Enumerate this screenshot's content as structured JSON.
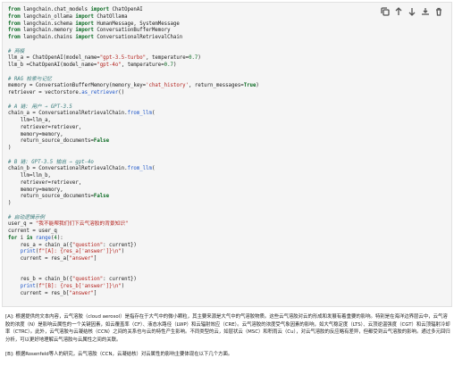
{
  "toolbar": {
    "icons": [
      "copy-icon",
      "move-up-icon",
      "move-down-icon",
      "download-icon",
      "delete-icon"
    ]
  },
  "code_lines": [
    [
      {
        "t": "from",
        "c": "kw"
      },
      {
        "t": " langchain.chat_models "
      },
      {
        "t": "import",
        "c": "kw"
      },
      {
        "t": " ChatOpenAI"
      }
    ],
    [
      {
        "t": "from",
        "c": "kw"
      },
      {
        "t": " langchain_ollama "
      },
      {
        "t": "import",
        "c": "kw"
      },
      {
        "t": " ChatOllama"
      }
    ],
    [
      {
        "t": "from",
        "c": "kw"
      },
      {
        "t": " langchain.schema "
      },
      {
        "t": "import",
        "c": "kw"
      },
      {
        "t": " HumanMessage, SystemMessage"
      }
    ],
    [
      {
        "t": "from",
        "c": "kw"
      },
      {
        "t": " langchain.memory "
      },
      {
        "t": "import",
        "c": "kw"
      },
      {
        "t": " ConversationBufferMemory"
      }
    ],
    [
      {
        "t": "from",
        "c": "kw"
      },
      {
        "t": " langchain.chains "
      },
      {
        "t": "import",
        "c": "kw"
      },
      {
        "t": " ConversationalRetrievalChain"
      }
    ],
    [],
    [
      {
        "t": "# 两模",
        "c": "cm"
      }
    ],
    [
      {
        "t": "llm_a = ChatOpenAI(model_name="
      },
      {
        "t": "\"gpt-3.5-turbo\"",
        "c": "st"
      },
      {
        "t": ", temperature="
      },
      {
        "t": "0.7",
        "c": "nu"
      },
      {
        "t": ")"
      }
    ],
    [
      {
        "t": "llm_b =ChatOpenAI(model_name="
      },
      {
        "t": "\"gpt-4o\"",
        "c": "st"
      },
      {
        "t": ", temperature="
      },
      {
        "t": "0.7",
        "c": "nu"
      },
      {
        "t": ")"
      }
    ],
    [],
    [
      {
        "t": "# RAG 检索与记忆",
        "c": "cm"
      }
    ],
    [
      {
        "t": "memory = ConversationBufferMemory(memory_key="
      },
      {
        "t": "'chat_history'",
        "c": "st"
      },
      {
        "t": ", return_messages="
      },
      {
        "t": "True",
        "c": "kw"
      },
      {
        "t": ")"
      }
    ],
    [
      {
        "t": "retriever = vectorstore."
      },
      {
        "t": "as_retriever",
        "c": "fn"
      },
      {
        "t": "()"
      }
    ],
    [],
    [
      {
        "t": "# A 链: 用户 → GPT-3.5",
        "c": "cm"
      }
    ],
    [
      {
        "t": "chain_a = ConversationalRetrievalChain."
      },
      {
        "t": "from_llm",
        "c": "fn"
      },
      {
        "t": "("
      }
    ],
    [
      {
        "t": "    llm=llm_a,"
      }
    ],
    [
      {
        "t": "    retriever=retriever,"
      }
    ],
    [
      {
        "t": "    memory=memory,"
      }
    ],
    [
      {
        "t": "    return_source_documents="
      },
      {
        "t": "False",
        "c": "kw"
      }
    ],
    [
      {
        "t": ")"
      }
    ],
    [],
    [
      {
        "t": "# B 链: GPT-3.5 输出 → gpt-4o",
        "c": "cm"
      }
    ],
    [
      {
        "t": "chain_b = ConversationalRetrievalChain."
      },
      {
        "t": "from_llm",
        "c": "fn"
      },
      {
        "t": "("
      }
    ],
    [
      {
        "t": "    llm=llm_b,"
      }
    ],
    [
      {
        "t": "    retriever=retriever,"
      }
    ],
    [
      {
        "t": "    memory=memory,"
      }
    ],
    [
      {
        "t": "    return_source_documents="
      },
      {
        "t": "False",
        "c": "kw"
      }
    ],
    [
      {
        "t": ")"
      }
    ],
    [],
    [
      {
        "t": "# 启动逻辑示例",
        "c": "cm"
      }
    ],
    [
      {
        "t": "user_q = "
      },
      {
        "t": "\"我不能帮我们们下云气溶胶的背景知识\"",
        "c": "st"
      }
    ],
    [
      {
        "t": "current = user_q"
      }
    ],
    [
      {
        "t": "for",
        "c": "kw"
      },
      {
        "t": " i "
      },
      {
        "t": "in",
        "c": "kw"
      },
      {
        "t": " "
      },
      {
        "t": "range",
        "c": "fn"
      },
      {
        "t": "("
      },
      {
        "t": "4",
        "c": "nu"
      },
      {
        "t": "):"
      }
    ],
    [
      {
        "t": "    res_a = chain_a({"
      },
      {
        "t": "\"question\"",
        "c": "st"
      },
      {
        "t": ": current})"
      }
    ],
    [
      {
        "t": "    "
      },
      {
        "t": "print",
        "c": "fn"
      },
      {
        "t": "("
      },
      {
        "t": "f\"[A]: {res_a['answer']}\\n\"",
        "c": "st"
      },
      {
        "t": ")"
      }
    ],
    [
      {
        "t": "    current = res_a["
      },
      {
        "t": "\"answer\"",
        "c": "st"
      },
      {
        "t": "]"
      }
    ],
    [],
    [],
    [
      {
        "t": "    res_b = chain_b({"
      },
      {
        "t": "\"question\"",
        "c": "st"
      },
      {
        "t": ": current})"
      }
    ],
    [
      {
        "t": "    "
      },
      {
        "t": "print",
        "c": "fn"
      },
      {
        "t": "("
      },
      {
        "t": "f\"[B]: {res_b['answer']}\\n\"",
        "c": "st"
      },
      {
        "t": ")"
      }
    ],
    [
      {
        "t": "    current = res_b["
      },
      {
        "t": "\"answer\"",
        "c": "st"
      },
      {
        "t": "]"
      }
    ]
  ],
  "output": {
    "para_a": "[A]: 根据提供的文本内容，云气溶胶（cloud aerosol）是指存在于大气中的微小颗粒，其主要来源是大气中的气溶胶物质。这些云气溶胶对云的形成和发展有着重要的影响。特别是在海洋边界层云中，云气溶胶的浓度（N）是影响云属性的一个关键因素，如云覆盖率（CF）、液态水路径（LWP）和云辐射效应（CRE）。云气溶胶的浓度受气象因素的影响，如大气稳定度（LTS）、云顶逆温强度（CGT）和云顶辐射冷却率（CTRC）。此外，云气溶胶与云凝结核（CCN）之间的关系也与云的特性产生影响。不同类型的云，如层状云（MSC）和积雨云（Cu），对云气溶胶的反应略有差异，但都受到云气溶胶的影响。通过多元回归分析，可以更好地理解云气溶胶与云属性之间的关联。",
    "para_b": "[B]: 根据Rosenfeld等人的研究，云气溶胶（CCN，云凝结核）对云属性的影响主要体现在以下几个方面。"
  }
}
